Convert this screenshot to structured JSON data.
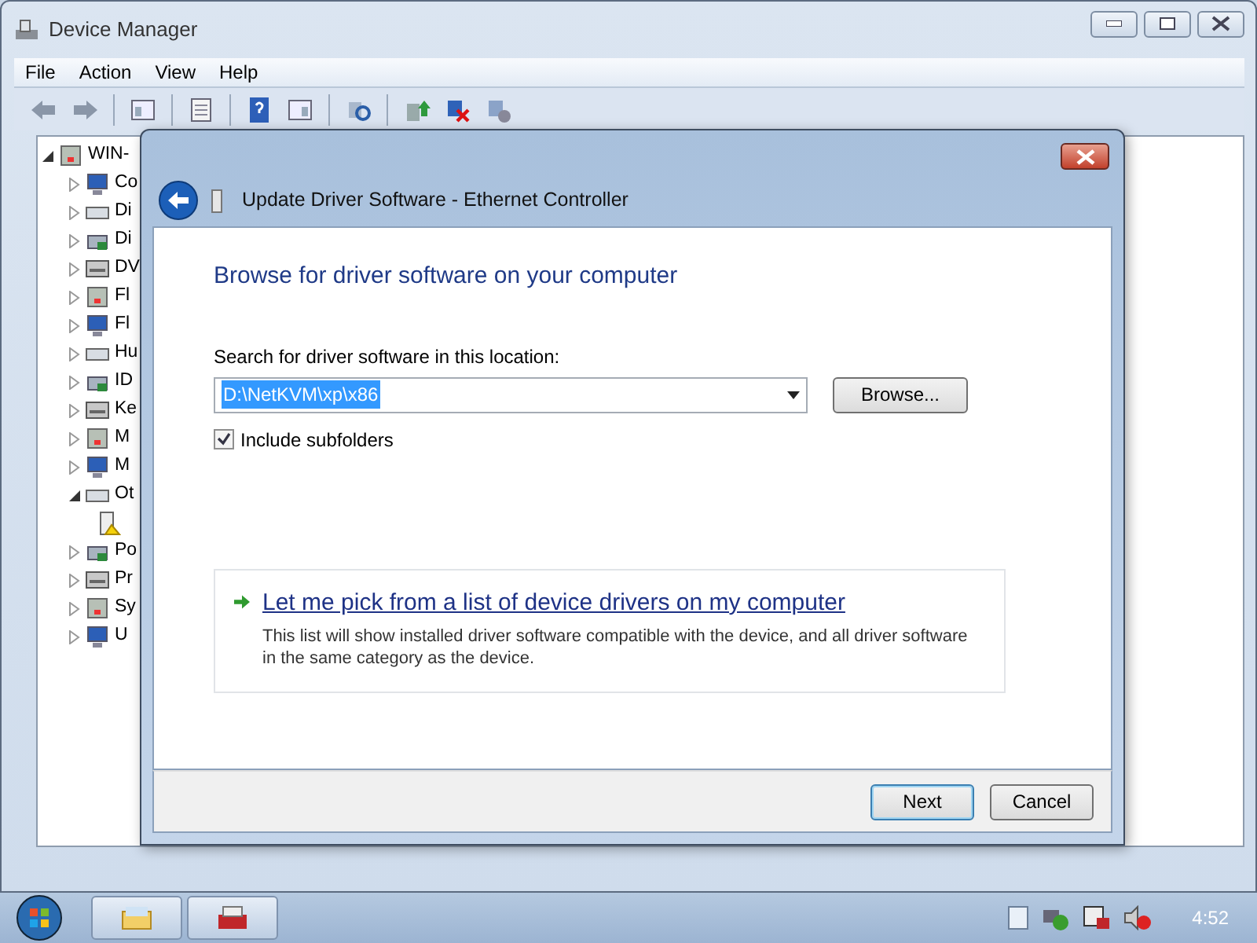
{
  "window": {
    "title": "Device Manager"
  },
  "menu": [
    {
      "label": "File"
    },
    {
      "label": "Action"
    },
    {
      "label": "View"
    },
    {
      "label": "Help"
    }
  ],
  "tree": {
    "label": "WIN-",
    "expanded": true,
    "children": [
      {
        "label": "Co",
        "expanded": false
      },
      {
        "label": "Di",
        "expanded": false
      },
      {
        "label": "Di",
        "expanded": false
      },
      {
        "label": "DV",
        "expanded": false
      },
      {
        "label": "Fl",
        "expanded": false
      },
      {
        "label": "Fl",
        "expanded": false
      },
      {
        "label": "Hu",
        "expanded": false
      },
      {
        "label": "ID",
        "expanded": false
      },
      {
        "label": "Ke",
        "expanded": false
      },
      {
        "label": "M",
        "expanded": false
      },
      {
        "label": "M",
        "expanded": false
      },
      {
        "label": "Ot",
        "expanded": true,
        "children": [
          {
            "warning": true
          }
        ]
      },
      {
        "label": "Po",
        "expanded": false
      },
      {
        "label": "Pr",
        "expanded": false
      },
      {
        "label": "Sy",
        "expanded": false
      },
      {
        "label": "U",
        "expanded": false
      }
    ]
  },
  "dialog": {
    "title": "Update Driver Software - Ethernet Controller",
    "heading": "Browse for driver software on your computer",
    "location_label": "Search for driver software in this location:",
    "location": {
      "value": "D:\\NetKVM\\xp\\x86",
      "selected": true
    },
    "browse_button": "Browse...",
    "include_subfolders": {
      "label": "Include subfolders",
      "checked": true
    },
    "option": {
      "title": "Let me pick from a list of device drivers on my computer",
      "description": "This list will show installed driver software compatible with the device, and all driver software in the same category as the device."
    },
    "buttons": [
      {
        "label": "Next",
        "default": true
      },
      {
        "label": "Cancel",
        "default": false
      }
    ]
  },
  "taskbar": {
    "clock": "4:52"
  }
}
